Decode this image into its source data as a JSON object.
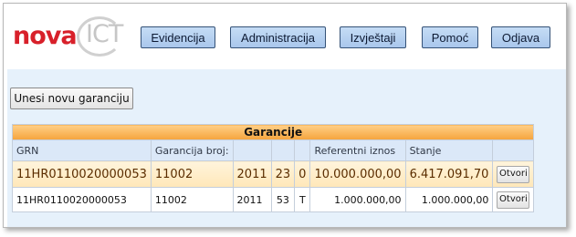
{
  "logo": {
    "nova": "nova",
    "ict": "ICT"
  },
  "nav": [
    {
      "label": "Evidencija"
    },
    {
      "label": "Administracija"
    },
    {
      "label": "Izvještaji"
    },
    {
      "label": "Pomoć"
    },
    {
      "label": "Odjava"
    }
  ],
  "new_button": "Unesi novu garanciju",
  "table": {
    "title": "Garancije",
    "headers": [
      "GRN",
      "Garancija broj:",
      "",
      "",
      "",
      "Referentni iznos",
      "Stanje",
      ""
    ],
    "rows": [
      {
        "grn": "11HR0110020000053",
        "broj": "11002",
        "god": "2011",
        "n": "23",
        "t": "0",
        "iznos": "10.000.000,00",
        "stanje": "6.417.091,70",
        "action": "Otvori"
      },
      {
        "grn": "11HR0110020000053",
        "broj": "11002",
        "god": "2011",
        "n": "53",
        "t": "T",
        "iznos": "1.000.000,00",
        "stanje": "1.000.000,00",
        "action": "Otvori"
      }
    ]
  },
  "colors": {
    "accent_orange": "#f5a43c",
    "nav_blue": "#a9c7ec",
    "content_bg": "#e6f1fb",
    "logo_red": "#d8202a"
  }
}
